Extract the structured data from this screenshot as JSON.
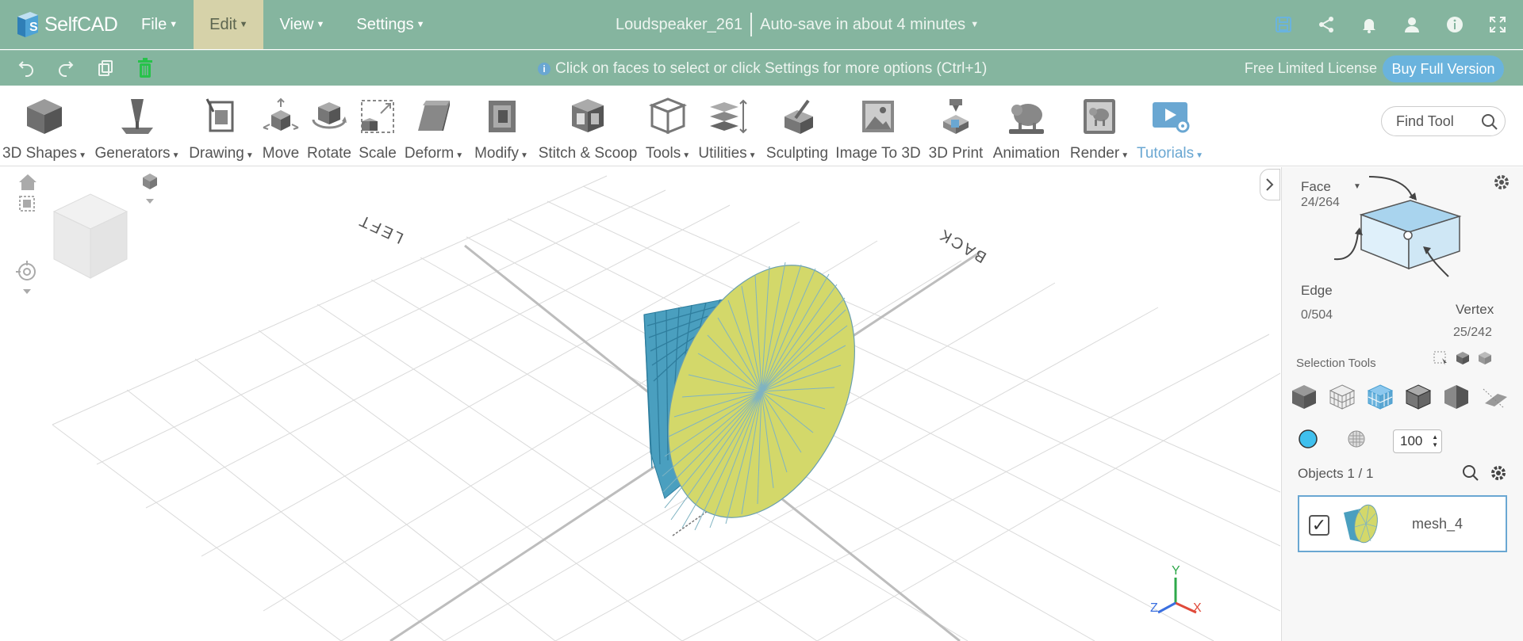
{
  "app": {
    "name": "SelfCAD"
  },
  "menu": [
    {
      "label": "File",
      "active": false
    },
    {
      "label": "Edit",
      "active": true
    },
    {
      "label": "View",
      "active": false
    },
    {
      "label": "Settings",
      "active": false
    }
  ],
  "document": {
    "title": "Loudspeaker_261",
    "autosave": "Auto-save in about 4 minutes"
  },
  "hint": "Click on faces to select or click Settings for more options (Ctrl+1)",
  "license": {
    "text": "Free Limited License",
    "buy_label": "Buy Full Version"
  },
  "tools": [
    {
      "label": "3D Shapes",
      "caret": true,
      "icon": "cube-icon"
    },
    {
      "label": "Generators",
      "caret": true,
      "icon": "generator-icon"
    },
    {
      "label": "Drawing",
      "caret": true,
      "icon": "drawing-icon"
    },
    {
      "label": "Move",
      "caret": false,
      "icon": "move-icon"
    },
    {
      "label": "Rotate",
      "caret": false,
      "icon": "rotate-icon"
    },
    {
      "label": "Scale",
      "caret": false,
      "icon": "scale-icon"
    },
    {
      "label": "Deform",
      "caret": true,
      "icon": "deform-icon"
    },
    {
      "label": "Modify",
      "caret": true,
      "icon": "modify-icon"
    },
    {
      "label": "Stitch & Scoop",
      "caret": false,
      "icon": "stitch-scoop-icon"
    },
    {
      "label": "Tools",
      "caret": true,
      "icon": "tools-icon"
    },
    {
      "label": "Utilities",
      "caret": true,
      "icon": "utilities-icon"
    },
    {
      "label": "Sculpting",
      "caret": false,
      "icon": "sculpting-icon"
    },
    {
      "label": "Image To 3D",
      "caret": false,
      "icon": "image-to-3d-icon"
    },
    {
      "label": "3D Print",
      "caret": false,
      "icon": "3d-print-icon"
    },
    {
      "label": "Animation",
      "caret": false,
      "icon": "animation-icon"
    },
    {
      "label": "Render",
      "caret": true,
      "icon": "render-icon"
    },
    {
      "label": "Tutorials",
      "caret": true,
      "icon": "tutorials-icon"
    }
  ],
  "find_tool": {
    "placeholder": "Find Tool"
  },
  "viewport": {
    "labels": {
      "left": "LEFT",
      "back": "BACK"
    },
    "axes": {
      "x": "X",
      "y": "Y",
      "z": "Z"
    },
    "colors": {
      "face": "#d3d86a",
      "cone": "#4a9fbf",
      "grid": "#d8d8d8"
    }
  },
  "selection": {
    "face": {
      "label": "Face",
      "count": "24/264"
    },
    "edge": {
      "label": "Edge",
      "count": "0/504"
    },
    "vertex": {
      "label": "Vertex",
      "count": "25/242"
    },
    "tools_label": "Selection Tools",
    "opacity": "100"
  },
  "objects": {
    "label": "Objects 1 / 1",
    "items": [
      {
        "name": "mesh_4",
        "checked": true
      }
    ]
  },
  "colors": {
    "menubar": "#85b59f",
    "accent": "#6ab3dd",
    "active_menu": "#d6d2a9"
  }
}
